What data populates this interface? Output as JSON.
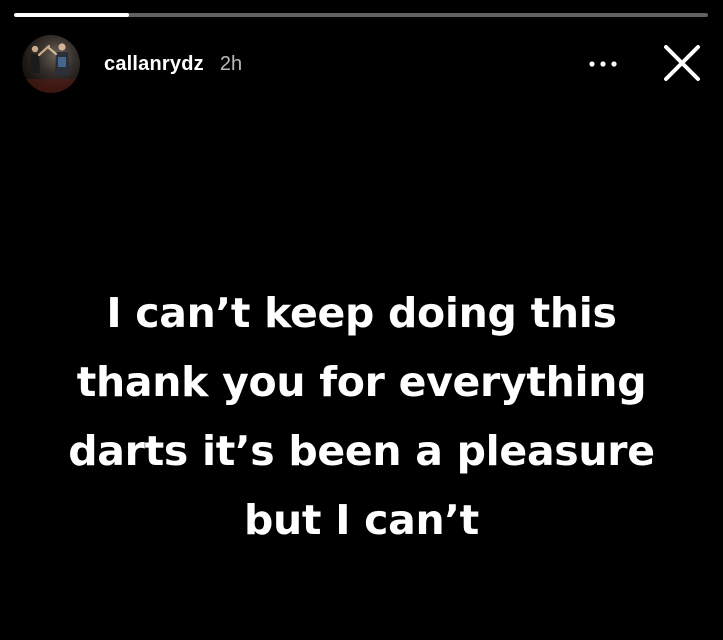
{
  "progress": {
    "fraction": 0.165
  },
  "header": {
    "username": "callanrydz",
    "timestamp": "2h",
    "avatar_icon": "profile-photo-avatar",
    "more_icon": "more-options-icon",
    "close_icon": "close-icon"
  },
  "story": {
    "lines": [
      "I can’t keep doing this",
      "thank you for everything",
      "darts it’s been a pleasure",
      "but I can’t"
    ]
  },
  "colors": {
    "background": "#000000",
    "text": "#ffffff",
    "progress_track": "rgba(255,255,255,0.38)"
  }
}
